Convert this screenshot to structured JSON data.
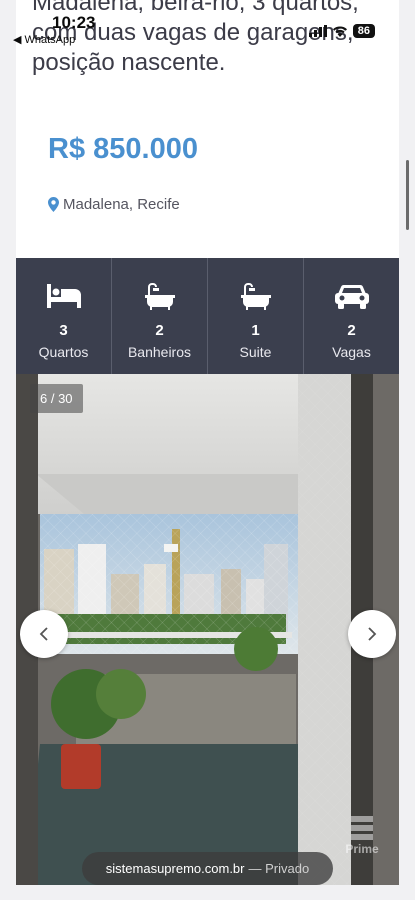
{
  "status_bar": {
    "time": "10:23",
    "back_app": "WhatsApp",
    "battery": "86"
  },
  "listing": {
    "title": "Madalena, beira-rio, 3 quartos, com duas vagas de garagens, posição nascente.",
    "price": "R$ 850.000",
    "location": "Madalena, Recife"
  },
  "features": [
    {
      "icon": "bed-icon",
      "value": "3",
      "label": "Quartos"
    },
    {
      "icon": "bathtub-icon",
      "value": "2",
      "label": "Banheiros"
    },
    {
      "icon": "bathtub-icon",
      "value": "1",
      "label": "Suite"
    },
    {
      "icon": "car-icon",
      "value": "2",
      "label": "Vagas"
    }
  ],
  "gallery": {
    "counter": "6 / 30",
    "watermark": "Prime"
  },
  "browser": {
    "url": "sistemasupremo.com.br",
    "mode": "— Privado"
  },
  "colors": {
    "price": "#4a90cf",
    "features_bg": "#3b3f4e",
    "background": "#f1f1f3"
  }
}
